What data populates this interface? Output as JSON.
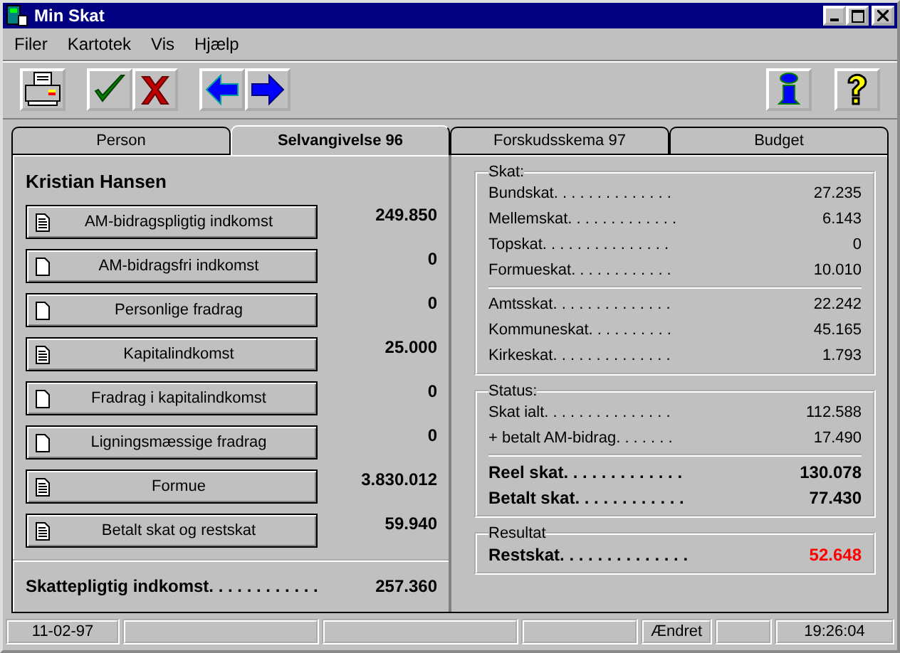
{
  "window": {
    "title": "Min Skat"
  },
  "menu": [
    "Filer",
    "Kartotek",
    "Vis",
    "Hjælp"
  ],
  "tabs": [
    {
      "label": "Person",
      "selected": false
    },
    {
      "label": "Selvangivelse 96",
      "selected": true
    },
    {
      "label": "Forskudsskema 97",
      "selected": false
    },
    {
      "label": "Budget",
      "selected": false
    }
  ],
  "person": {
    "name": "Kristian Hansen"
  },
  "entries": [
    {
      "label": "AM-bidragspligtig indkomst",
      "filled": true,
      "value": "249.850"
    },
    {
      "label": "AM-bidragsfri indkomst",
      "filled": false,
      "value": "0"
    },
    {
      "label": "Personlige fradrag",
      "filled": false,
      "value": "0"
    },
    {
      "label": "Kapitalindkomst",
      "filled": true,
      "value": "25.000"
    },
    {
      "label": "Fradrag i kapitalindkomst",
      "filled": false,
      "value": "0"
    },
    {
      "label": "Ligningsmæssige fradrag",
      "filled": false,
      "value": "0"
    },
    {
      "label": "Formue",
      "filled": true,
      "value": "3.830.012"
    },
    {
      "label": "Betalt skat og restskat",
      "filled": true,
      "value": "59.940"
    }
  ],
  "total": {
    "label": "Skattepligtig indkomst. . . . . . . . . . . .",
    "value": "257.360"
  },
  "groups": [
    {
      "title": "Skat:",
      "sections": [
        [
          {
            "label": "Bundskat. . . . . . . . . . . . . .",
            "value": "27.235",
            "bold": false
          },
          {
            "label": "Mellemskat. . . . . . . . . . . . .",
            "value": "6.143",
            "bold": false
          },
          {
            "label": "Topskat. . . . . . . . . . . . . . .",
            "value": "0",
            "bold": false
          },
          {
            "label": "Formueskat. . . . . . . . . . . .",
            "value": "10.010",
            "bold": false
          }
        ],
        [
          {
            "label": "Amtsskat. . . . . . . . . . . . . .",
            "value": "22.242",
            "bold": false
          },
          {
            "label": "Kommuneskat. . . . . . . . . .",
            "value": "45.165",
            "bold": false
          },
          {
            "label": "Kirkeskat. . . . . . . . . . . . . .",
            "value": "1.793",
            "bold": false
          }
        ]
      ]
    },
    {
      "title": "Status:",
      "sections": [
        [
          {
            "label": "Skat ialt. . . . . . . . . . . . . . .",
            "value": "112.588",
            "bold": false
          },
          {
            "label": "+ betalt AM-bidrag. . . . . . .",
            "value": "17.490",
            "bold": false
          }
        ],
        [
          {
            "label": "Reel skat. . . . . . . . . . . . .",
            "value": "130.078",
            "bold": true
          },
          {
            "label": "Betalt skat. . . . . . . . . . . .",
            "value": "77.430",
            "bold": true
          }
        ]
      ]
    },
    {
      "title": "Resultat",
      "sections": [
        [
          {
            "label": "Restskat. . . . . . . . . . . . . .",
            "value": "52.648",
            "bold": true,
            "color": "#ff0000"
          }
        ]
      ]
    }
  ],
  "status_bar": {
    "date": "11-02-97",
    "state": "Ændret",
    "time": "19:26:04"
  }
}
